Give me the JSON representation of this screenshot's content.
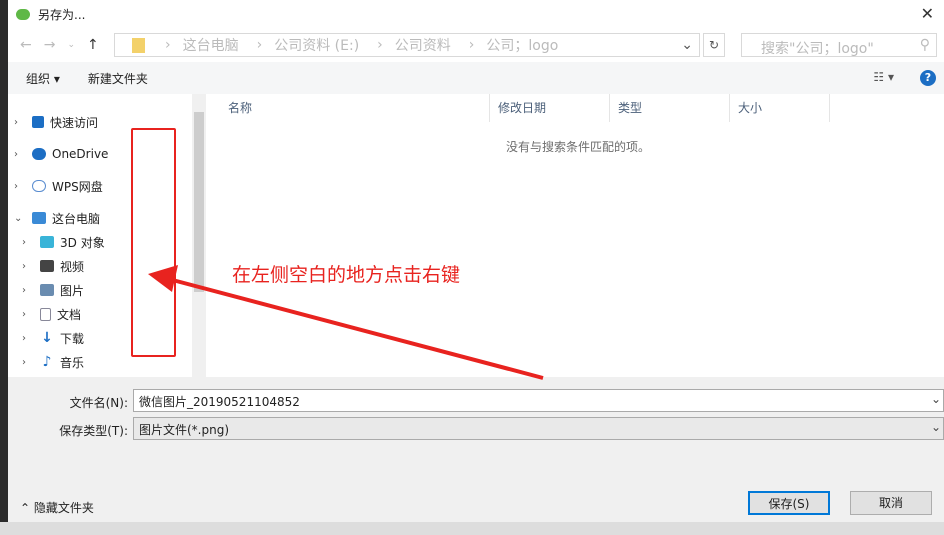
{
  "window": {
    "title": "另存为..."
  },
  "nav": {
    "breadcrumbs": [
      "这台电脑",
      "公司资料 (E:)",
      "公司资料",
      "公司；logo"
    ],
    "search_placeholder": "搜索\"公司；logo\""
  },
  "toolbar": {
    "organize": "组织 ▾",
    "new_folder": "新建文件夹"
  },
  "tree": [
    {
      "label": "快速访问",
      "icon": "star-icon",
      "color": "#1c6ec4"
    },
    {
      "label": "OneDrive",
      "icon": "cloud-icon",
      "color": "#1c6ec4"
    },
    {
      "label": "WPS网盘",
      "icon": "cloud-outline-icon",
      "color": "#5a8dd0"
    },
    {
      "label": "这台电脑",
      "icon": "computer-icon",
      "color": "#3a8ad6"
    },
    {
      "label": "3D 对象",
      "icon": "cube-icon",
      "color": "#39b4d8"
    },
    {
      "label": "视频",
      "icon": "film-icon",
      "color": "#444"
    },
    {
      "label": "图片",
      "icon": "picture-icon",
      "color": "#6a8cb0"
    },
    {
      "label": "文档",
      "icon": "document-icon",
      "color": "#8aa"
    },
    {
      "label": "下载",
      "icon": "download-icon",
      "color": "#1c6ec4"
    },
    {
      "label": "音乐",
      "icon": "music-icon",
      "color": "#1c6ec4"
    }
  ],
  "columns": [
    "名称",
    "修改日期",
    "类型",
    "大小"
  ],
  "empty_message": "没有与搜索条件匹配的项。",
  "filename": {
    "label": "文件名(N):",
    "value": "微信图片_20190521104852"
  },
  "filetype": {
    "label": "保存类型(T):",
    "value": "图片文件(*.png)"
  },
  "hide_folders": "隐藏文件夹",
  "buttons": {
    "save": "保存(S)",
    "cancel": "取消"
  },
  "annotation": {
    "text": "在左侧空白的地方点击右键",
    "color": "#e8231f"
  }
}
